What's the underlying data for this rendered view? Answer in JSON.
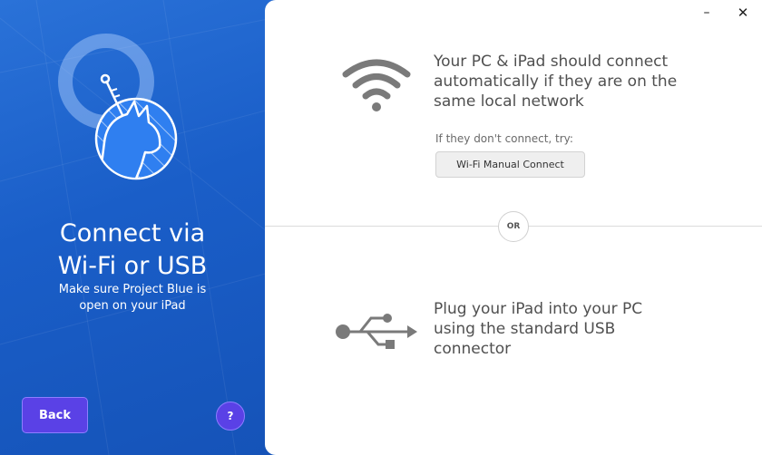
{
  "left": {
    "heading_line1": "Connect via",
    "heading_line2": "Wi-Fi or USB",
    "sub_line1": "Make sure Project Blue is",
    "sub_line2": "open on your iPad",
    "back_label": "Back",
    "help_label": "?"
  },
  "window": {
    "minimize_glyph": "–",
    "close_glyph": "✕"
  },
  "wifi": {
    "icon": "wifi-icon",
    "line1": "Your PC & iPad should connect",
    "line2": "automatically if they are on the",
    "line3": "same local network",
    "try_label": "If they don't connect, try:",
    "button_label": "Wi-Fi Manual Connect"
  },
  "divider": {
    "or_label": "OR"
  },
  "usb": {
    "icon": "usb-icon",
    "line1": "Plug your iPad into your PC",
    "line2": "using the standard USB",
    "line3": "connector"
  },
  "colors": {
    "left_panel": "#1a5ec8",
    "button_purple": "#5a41e6",
    "icon_gray": "#7a7a7a"
  }
}
